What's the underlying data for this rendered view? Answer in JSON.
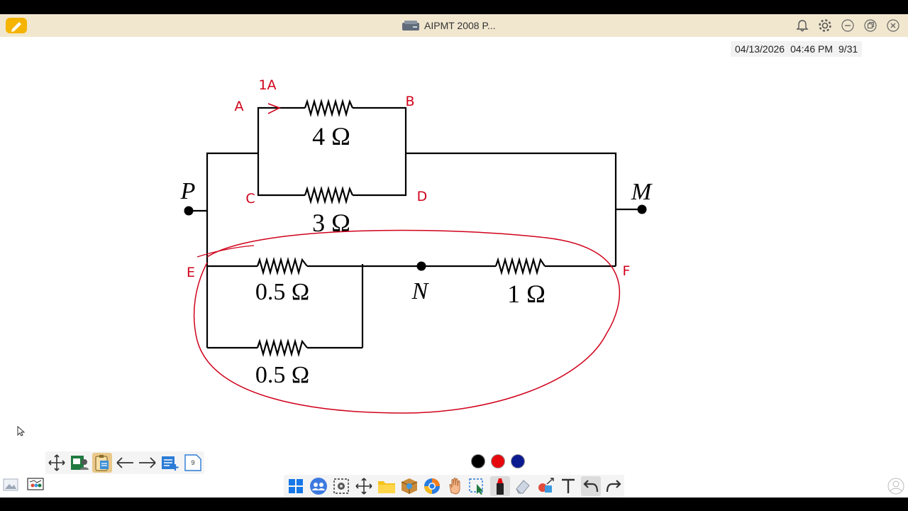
{
  "window": {
    "title": "AIPMT 2008 P..."
  },
  "status": {
    "date": "04/13/2026",
    "time": "04:46 PM",
    "page": "9/31"
  },
  "circuit": {
    "resistors": {
      "r_ab": "4 Ω",
      "r_cd": "3 Ω",
      "r_e_top": "0.5 Ω",
      "r_e_bottom": "0.5 Ω",
      "r_nf": "1 Ω"
    },
    "nodes": {
      "p": "P",
      "m": "M",
      "n": "N"
    }
  },
  "annotations": {
    "current": "1A",
    "a": "A",
    "b": "B",
    "c": "C",
    "d": "D",
    "e": "E",
    "f": "F",
    "ink_color": "#d0021b"
  },
  "toolbar_left": {
    "page_badge": "9"
  },
  "colors": {
    "black": "#000000",
    "red": "#e5090e",
    "blue": "#0b1a8f"
  },
  "main_toolbar": {
    "tools": [
      "windows-icon",
      "people-icon",
      "screenshot-icon",
      "move-icon",
      "folder-icon",
      "box-icon",
      "browser-icon",
      "hand-icon",
      "select-icon",
      "marker-icon",
      "eraser-icon",
      "shapes-icon",
      "text-icon",
      "undo-icon",
      "redo-icon"
    ]
  }
}
